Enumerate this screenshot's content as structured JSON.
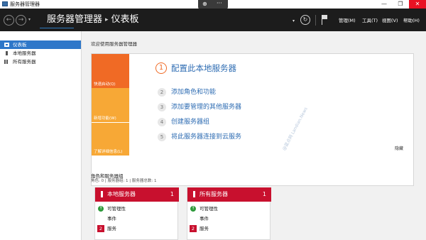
{
  "window": {
    "title": "服务器管理器",
    "overlay": {
      "zoom_glyph": "⊕",
      "more_glyph": "···"
    },
    "controls": {
      "minimize": "—",
      "maximize": "❐",
      "close": "✕"
    }
  },
  "header": {
    "breadcrumb": {
      "root": "服务器管理器",
      "separator": "▸",
      "current": "仪表板"
    },
    "menus": [
      "管理(M)",
      "工具(T)",
      "视图(V)",
      "帮助(H)"
    ]
  },
  "sidebar": {
    "items": [
      {
        "label": "仪表板",
        "active": true
      },
      {
        "label": "本地服务器",
        "active": false
      },
      {
        "label": "所有服务器",
        "active": false
      }
    ]
  },
  "main": {
    "welcome": "欢迎使用服务器管理器",
    "tiles": [
      "快速启动(Q)",
      "新增功能(W)",
      "了解详细信息(L)"
    ],
    "steps": [
      {
        "num": "1",
        "text": "配置此本地服务器"
      },
      {
        "num": "2",
        "text": "添加角色和功能"
      },
      {
        "num": "3",
        "text": "添加要管理的其他服务器"
      },
      {
        "num": "4",
        "text": "创建服务器组"
      },
      {
        "num": "5",
        "text": "将此服务器连接到云服务"
      }
    ],
    "hide_label": "隐藏",
    "watermark": "@蓝点网 Landian.News",
    "roles": {
      "title": "角色和服务器组",
      "subtitle": "角色: 0 | 服务器组: 1 | 服务器总数: 1"
    },
    "cards": [
      {
        "name": "本地服务器",
        "count": "1",
        "rows": {
          "manageability": "可管理性",
          "events": "事件",
          "services": "服务",
          "services_count": "2"
        }
      },
      {
        "name": "所有服务器",
        "count": "1",
        "rows": {
          "manageability": "可管理性",
          "events": "事件",
          "services": "服务",
          "services_count": "2"
        }
      }
    ]
  },
  "colors": {
    "accent_blue": "#2e77c9",
    "tile_orange": "#f06a25",
    "tile_amber": "#f7a836",
    "card_red": "#c8102e",
    "header_bg": "#1c1c1c",
    "link_blue": "#2f6db3"
  }
}
